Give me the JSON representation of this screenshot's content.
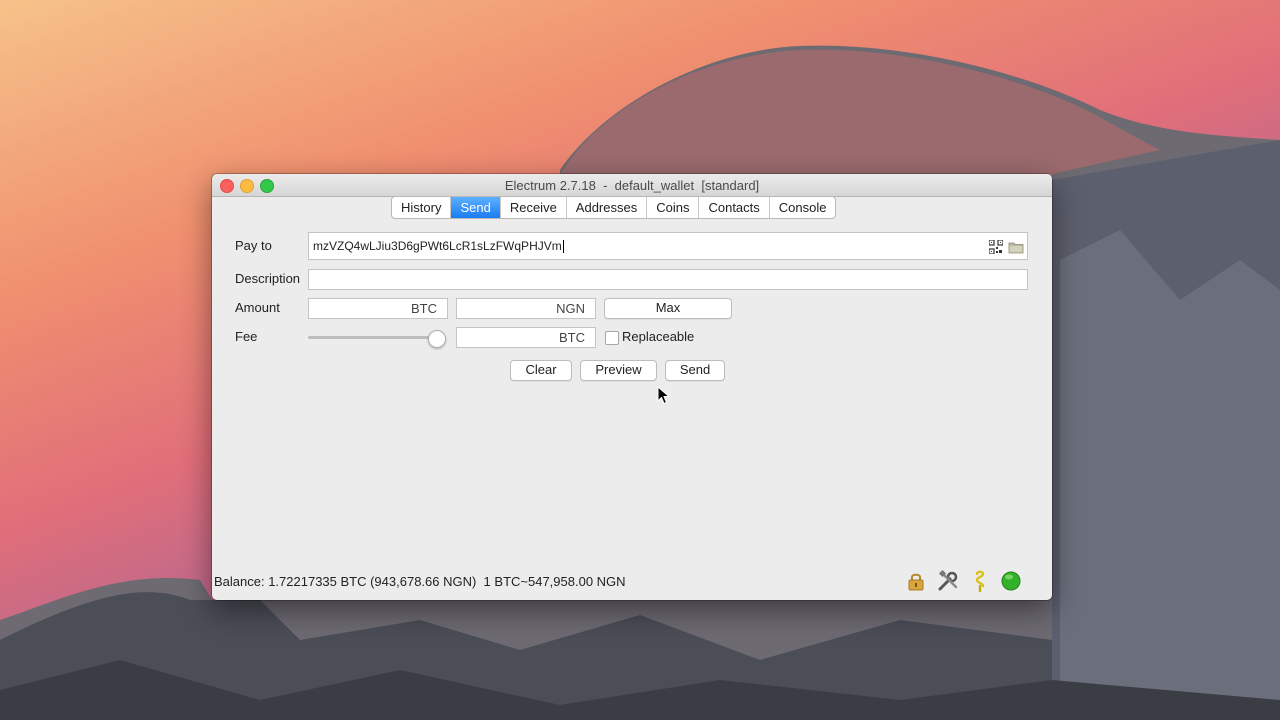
{
  "window": {
    "title": "Electrum 2.7.18  -  default_wallet  [standard]"
  },
  "tabs": [
    {
      "label": "History"
    },
    {
      "label": "Send",
      "active": true
    },
    {
      "label": "Receive"
    },
    {
      "label": "Addresses"
    },
    {
      "label": "Coins"
    },
    {
      "label": "Contacts"
    },
    {
      "label": "Console"
    }
  ],
  "send_form": {
    "pay_to_label": "Pay to",
    "pay_to_value": "mzVZQ4wLJiu3D6gPWt6LcR1sLzFWqPHJVm",
    "description_label": "Description",
    "description_value": "",
    "amount_label": "Amount",
    "amount_btc_unit": "BTC",
    "amount_fiat_unit": "NGN",
    "max_button": "Max",
    "fee_label": "Fee",
    "fee_btc_unit": "BTC",
    "fee_slider_fraction": 0.95,
    "replaceable_label": "Replaceable",
    "replaceable_checked": false,
    "clear_button": "Clear",
    "preview_button": "Preview",
    "send_button": "Send"
  },
  "statusbar": {
    "balance_text": "Balance: 1.72217335 BTC (943,678.66 NGN)  1 BTC~547,958.00 NGN",
    "icons": [
      "lock-icon",
      "preferences-icon",
      "seed-icon",
      "network-status-icon"
    ],
    "network_color": "#34b12a"
  },
  "colors": {
    "accent": "#1b7cf2"
  }
}
